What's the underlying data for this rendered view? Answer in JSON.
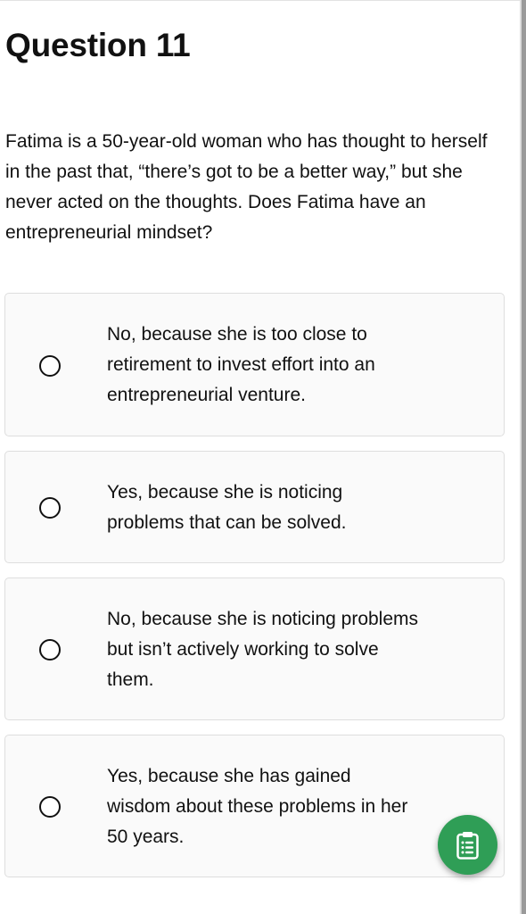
{
  "question": {
    "title": "Question 11",
    "text": "Fatima is a 50-year-old woman who has thought to herself in the past that, “there’s got to be a better way,” but she never acted on the thoughts. Does Fatima have an entrepreneurial mindset?"
  },
  "options": [
    {
      "label": "No, because she is too close to retirement to invest effort into an entrepreneurial venture.",
      "selected": false
    },
    {
      "label": "Yes, because she is noticing problems that can be solved.",
      "selected": false
    },
    {
      "label": "No, because she is noticing problems but isn’t actively working to solve them.",
      "selected": false
    },
    {
      "label": "Yes, because she has gained wisdom about these problems in her 50 years.",
      "selected": false
    }
  ],
  "fab": {
    "icon": "clipboard-list-icon",
    "color": "#2f9e56"
  }
}
